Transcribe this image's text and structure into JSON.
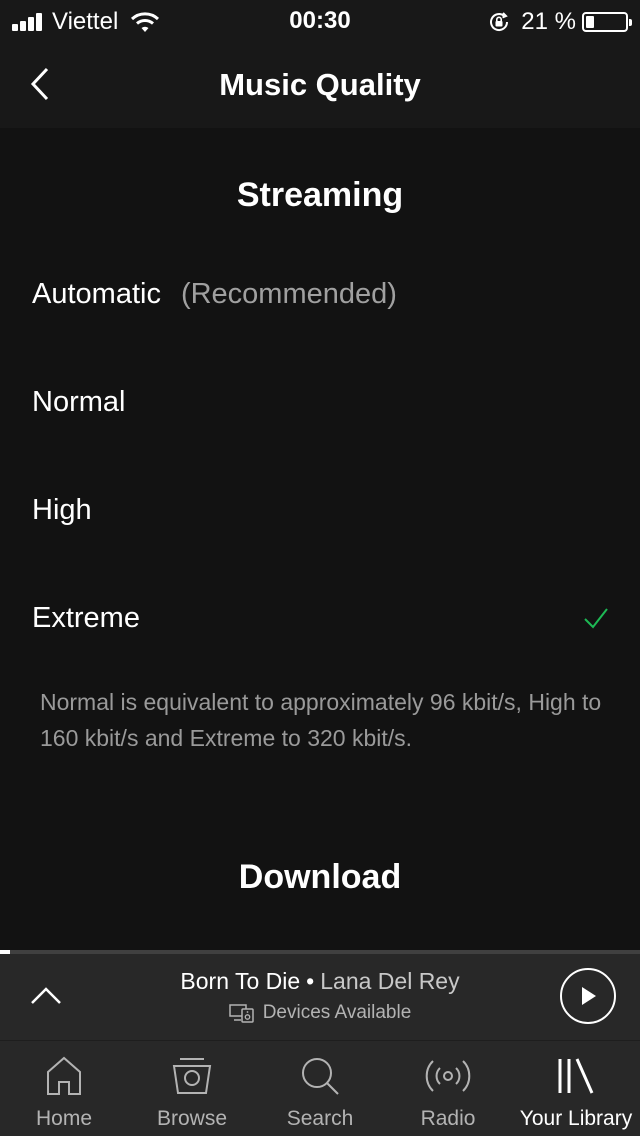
{
  "status_bar": {
    "carrier": "Viettel",
    "time": "00:30",
    "battery_percent": "21 %",
    "battery_level": 0.21,
    "icons": [
      "signal-icon",
      "wifi-icon",
      "rotation-lock-icon",
      "battery-icon"
    ]
  },
  "nav": {
    "title": "Music Quality",
    "back_icon": "chevron-left-icon"
  },
  "streaming": {
    "title": "Streaming",
    "options": [
      {
        "label": "Automatic",
        "sublabel": "(Recommended)",
        "selected": false
      },
      {
        "label": "Normal",
        "sublabel": "",
        "selected": false
      },
      {
        "label": "High",
        "sublabel": "",
        "selected": false
      },
      {
        "label": "Extreme",
        "sublabel": "",
        "selected": true
      }
    ],
    "note": "Normal is equivalent to approximately 96 kbit/s, High to 160 kbit/s and Extreme to 320 kbit/s."
  },
  "download": {
    "title": "Download"
  },
  "now_playing": {
    "track": "Born To Die",
    "separator": "•",
    "artist": "Lana Del Rey",
    "devices": "Devices Available",
    "progress": 0.015
  },
  "tabs": [
    {
      "label": "Home",
      "icon": "home-icon",
      "active": false
    },
    {
      "label": "Browse",
      "icon": "browse-icon",
      "active": false
    },
    {
      "label": "Search",
      "icon": "search-icon",
      "active": false
    },
    {
      "label": "Radio",
      "icon": "radio-icon",
      "active": false
    },
    {
      "label": "Your Library",
      "icon": "library-icon",
      "active": true
    }
  ],
  "colors": {
    "background": "#121212",
    "bar": "#282828",
    "accent_check": "#1db954"
  }
}
